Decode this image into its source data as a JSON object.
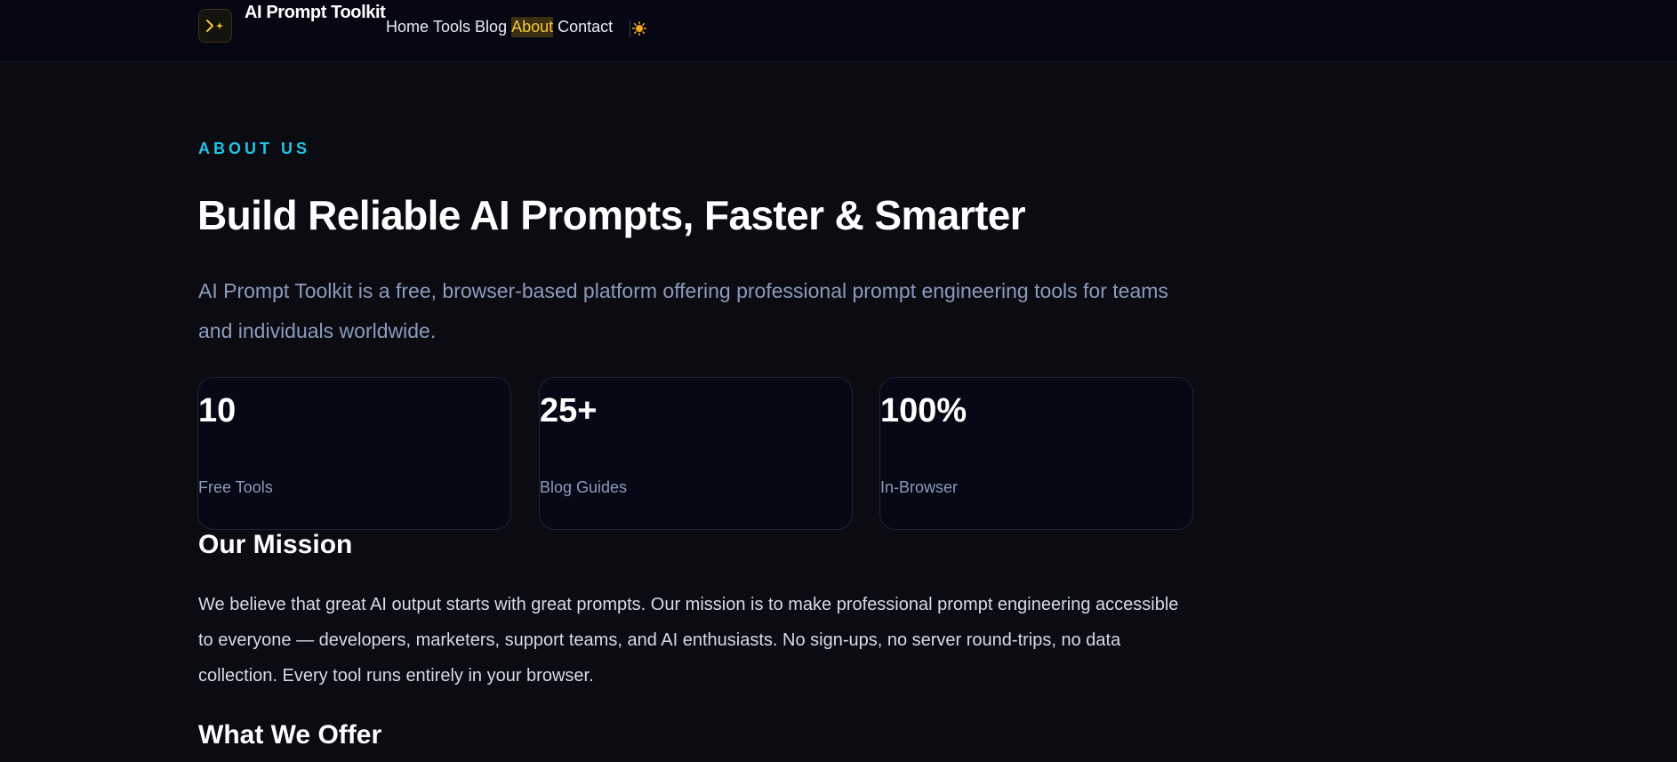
{
  "header": {
    "brand": "AI Prompt Toolkit",
    "nav": [
      {
        "label": "Home"
      },
      {
        "label": "Tools"
      },
      {
        "label": "Blog"
      },
      {
        "label": "About",
        "active": true
      },
      {
        "label": "Contact"
      }
    ],
    "theme_toggle_icon": "sun-icon",
    "logo_icon": "terminal-sparkle-icon"
  },
  "hero": {
    "eyebrow": "ABOUT US",
    "title": "Build Reliable AI Prompts, Faster & Smarter",
    "lead": "AI Prompt Toolkit is a free, browser-based platform offering professional prompt engineering tools for teams and individuals worldwide."
  },
  "stats": [
    {
      "value": "10",
      "label": "Free Tools"
    },
    {
      "value": "25+",
      "label": "Blog Guides"
    },
    {
      "value": "100%",
      "label": "In-Browser"
    }
  ],
  "mission": {
    "heading": "Our Mission",
    "text": "We believe that great AI output starts with great prompts. Our mission is to make professional prompt engineering accessible to everyone — developers, marketers, support teams, and AI enthusiasts. No sign-ups, no server round-trips, no data collection. Every tool runs entirely in your browser."
  },
  "offer": {
    "heading": "What We Offer"
  },
  "colors": {
    "background": "#0b0b12",
    "accent_cyan": "#22c3e6",
    "accent_amber": "#f5c542",
    "muted_text": "#8b9bbd"
  }
}
